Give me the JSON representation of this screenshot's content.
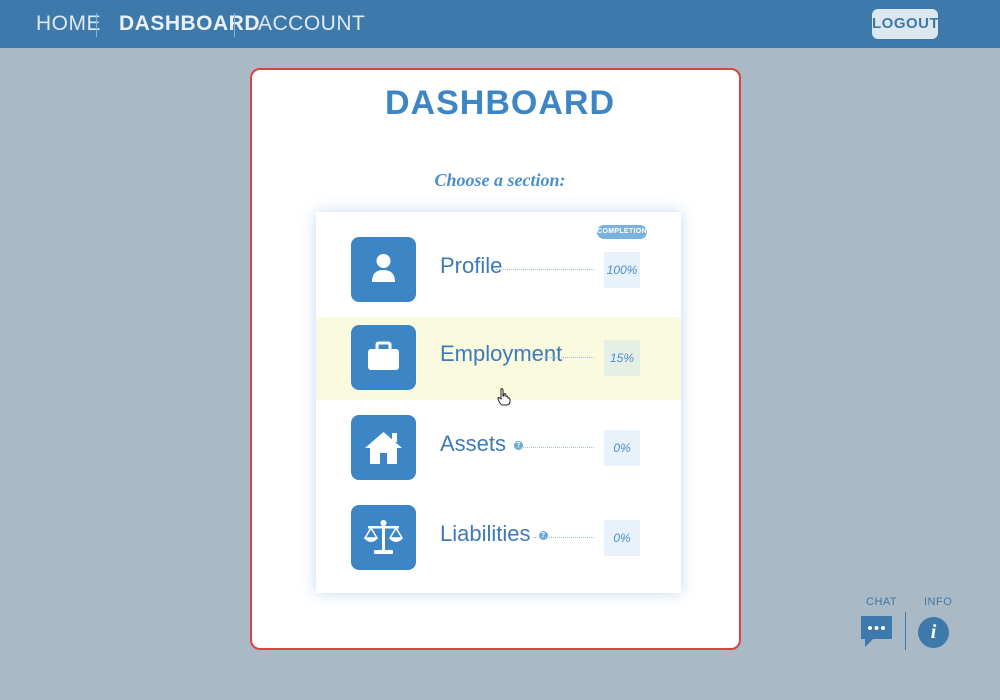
{
  "nav": {
    "items": [
      {
        "label": "HOME"
      },
      {
        "label": "DASHBOARD"
      },
      {
        "label": "ACCOUNT"
      }
    ],
    "logout_label": "LOGOUT"
  },
  "card": {
    "title": "DASHBOARD",
    "subtitle": "Choose a section:",
    "completion_label": "COMPLETION",
    "sections": [
      {
        "label": "Profile",
        "percent": "100%",
        "icon": "person-icon"
      },
      {
        "label": "Employment",
        "percent": "15%",
        "icon": "briefcase-icon"
      },
      {
        "label": "Assets",
        "percent": "0%",
        "icon": "house-icon",
        "help": "?"
      },
      {
        "label": "Liabilities",
        "percent": "0%",
        "icon": "scales-icon",
        "help": "?"
      }
    ]
  },
  "widgets": {
    "chat_label": "CHAT",
    "info_label": "INFO",
    "info_glyph": "i"
  },
  "colors": {
    "background": "#a9b9c5",
    "nav_bar": "#3d7aab",
    "accent_blue": "#3d86c6",
    "card_border": "#e04040",
    "hover_row": "#fafadf"
  }
}
